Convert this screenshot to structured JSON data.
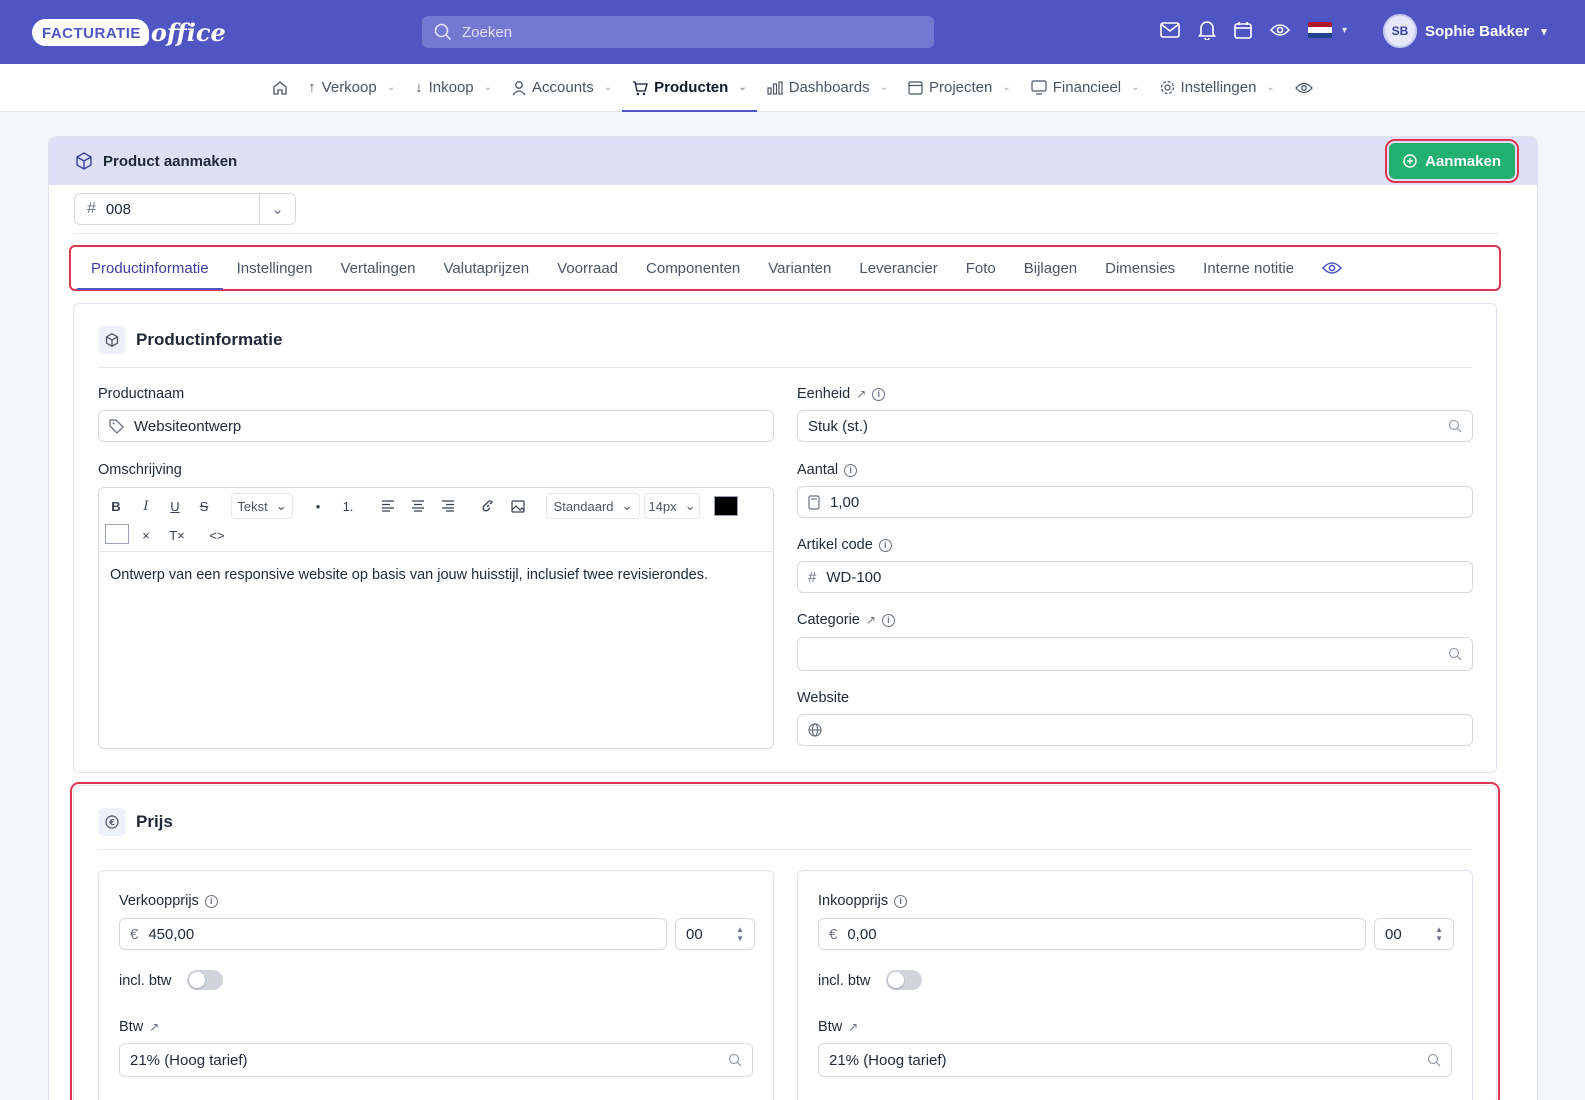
{
  "header": {
    "logo_left": "FACTURATIE",
    "logo_right": "office",
    "search_placeholder": "Zoeken",
    "user_initials": "SB",
    "user_name": "Sophie Bakker",
    "flag_colors": [
      "#ae1c28",
      "#ffffff",
      "#21468b"
    ]
  },
  "nav": {
    "items": [
      {
        "label": "Verkoop"
      },
      {
        "label": "Inkoop"
      },
      {
        "label": "Accounts"
      },
      {
        "label": "Producten"
      },
      {
        "label": "Dashboards"
      },
      {
        "label": "Projecten"
      },
      {
        "label": "Financieel"
      },
      {
        "label": "Instellingen"
      }
    ],
    "active": "Producten"
  },
  "page": {
    "title": "Product aanmaken",
    "create_button": "Aanmaken",
    "number_hash": "#",
    "number_value": "008"
  },
  "tabs": [
    "Productinformatie",
    "Instellingen",
    "Vertalingen",
    "Valutaprijzen",
    "Voorraad",
    "Componenten",
    "Varianten",
    "Leverancier",
    "Foto",
    "Bijlagen",
    "Dimensies",
    "Interne notitie"
  ],
  "info": {
    "title": "Productinformatie",
    "productnaam_label": "Productnaam",
    "productnaam_value": "Websiteontwerp",
    "omschrijving_label": "Omschrijving",
    "editor": {
      "bold": "B",
      "italic": "I",
      "underline": "U",
      "strike": "S",
      "format": "Tekst",
      "bullet": "•",
      "ordered": "1.",
      "font": "Standaard",
      "size": "14px",
      "clear": "×",
      "clear_format": "T×",
      "code": "<>",
      "text": "Ontwerp van een responsive website op basis van jouw huisstijl, inclusief twee revisierondes."
    },
    "eenheid_label": "Eenheid",
    "eenheid_value": "Stuk (st.)",
    "aantal_label": "Aantal",
    "aantal_value": "1,00",
    "artikel_label": "Artikel code",
    "artikel_hash": "#",
    "artikel_value": "WD-100",
    "categorie_label": "Categorie",
    "categorie_value": "",
    "website_label": "Website",
    "website_value": ""
  },
  "price": {
    "title": "Prijs",
    "currency": "€",
    "sell": {
      "label": "Verkoopprijs",
      "value": "450,00",
      "decimals": "00",
      "vat_incl_label": "incl. btw",
      "vat_label": "Btw",
      "vat_value": "21% (Hoog tarief)"
    },
    "buy": {
      "label": "Inkoopprijs",
      "value": "0,00",
      "decimals": "00",
      "vat_incl_label": "incl. btw",
      "vat_label": "Btw",
      "vat_value": "21% (Hoog tarief)"
    }
  },
  "colors": {
    "brand": "#4f56c4",
    "create": "#22b070",
    "highlight": "#e0364f"
  }
}
